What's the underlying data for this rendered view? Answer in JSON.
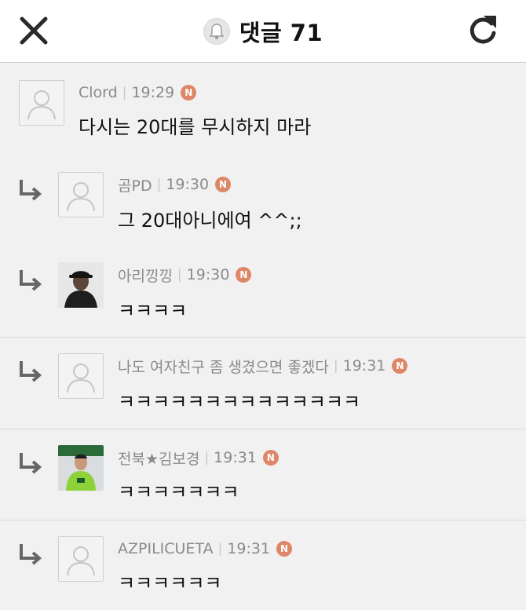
{
  "header": {
    "title": "댓글 71",
    "close_icon": "close-icon",
    "bell_icon": "bell-icon",
    "refresh_icon": "refresh-icon"
  },
  "comments": [
    {
      "author": "Clord",
      "time": "19:29",
      "badge": "N",
      "text": "다시는 20대를 무시하지 마라",
      "reply": false,
      "avatar": "default"
    },
    {
      "author": "곰PD",
      "time": "19:30",
      "badge": "N",
      "text": "그 20대아니에여 ^^;;",
      "reply": true,
      "avatar": "default"
    },
    {
      "author": "아리낑낑",
      "time": "19:30",
      "badge": "N",
      "text": "ㅋㅋㅋㅋ",
      "reply": true,
      "avatar": "photo-person-cap"
    },
    {
      "author": "나도 여자친구 좀 생겼으면 좋겠다",
      "time": "19:31",
      "badge": "N",
      "text": "ㅋㅋㅋㅋㅋㅋㅋㅋㅋㅋㅋㅋㅋㅋ",
      "reply": true,
      "avatar": "default"
    },
    {
      "author": "전북★김보경",
      "time": "19:31",
      "badge": "N",
      "text": "ㅋㅋㅋㅋㅋㅋㅋ",
      "reply": true,
      "avatar": "photo-soccer-player"
    },
    {
      "author": "AZPILICUETA",
      "time": "19:31",
      "badge": "N",
      "text": "ㅋㅋㅋㅋㅋㅋ",
      "reply": true,
      "avatar": "default"
    }
  ],
  "colors": {
    "background": "#f1f1f1",
    "header_bg": "#ffffff",
    "badge": "#dd8768",
    "meta_text": "#8a8a8a",
    "jersey_green": "#8ed23a"
  }
}
